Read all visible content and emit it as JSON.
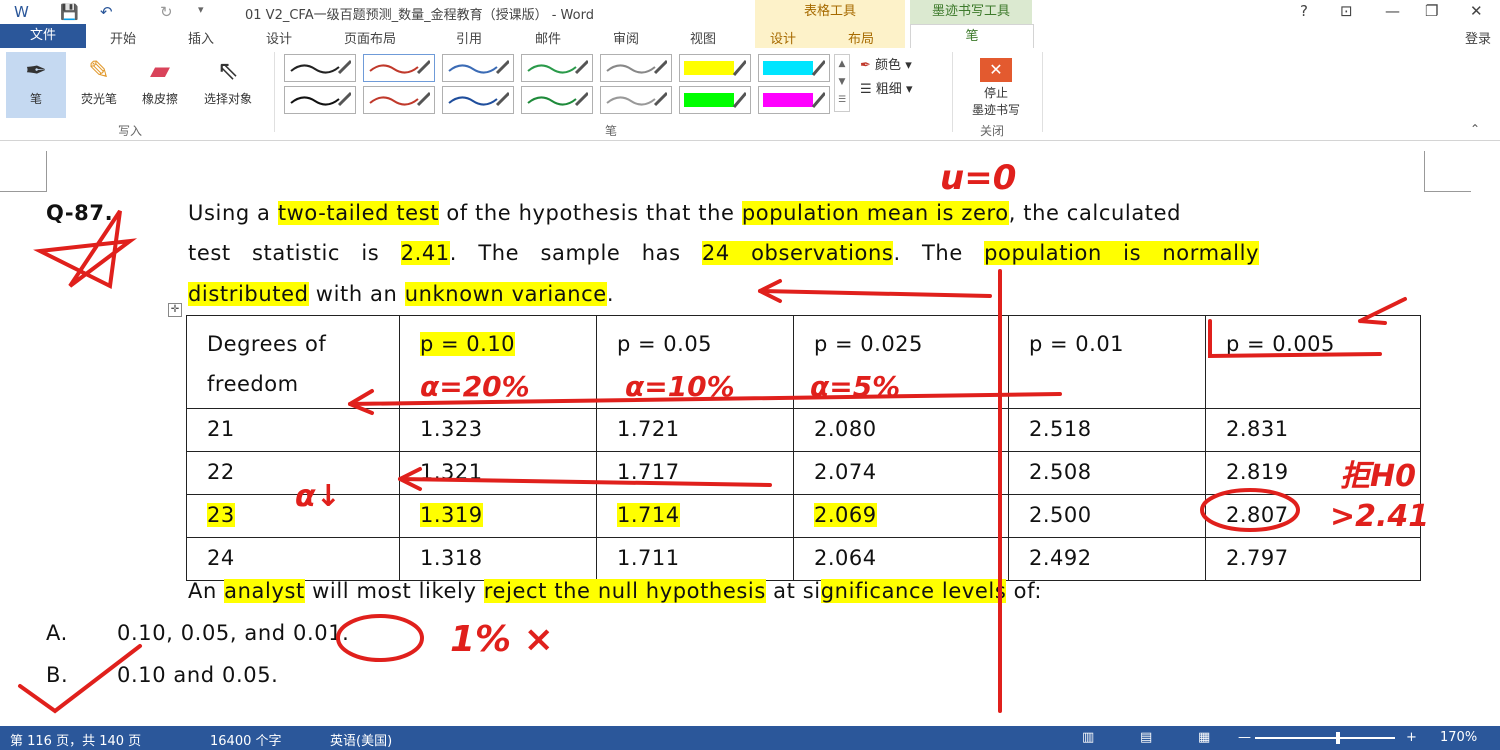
{
  "titlebar": {
    "title": "01 V2_CFA一级百题预测_数量_金程教育（授课版） - Word",
    "context_groups": [
      "表格工具",
      "墨迹书写工具"
    ],
    "help": "?",
    "login": "登录"
  },
  "tabs": {
    "file": "文件",
    "items": [
      "开始",
      "插入",
      "设计",
      "页面布局",
      "引用",
      "邮件",
      "审阅",
      "视图"
    ],
    "table_design": "设计",
    "table_layout": "布局",
    "pen": "笔"
  },
  "ribbon": {
    "write_tools": [
      "笔",
      "荧光笔",
      "橡皮擦",
      "选择对象"
    ],
    "write_group": "写入",
    "pen_group": "笔",
    "color": "颜色",
    "thickness": "粗细",
    "stop_label_1": "停止",
    "stop_label_2": "墨迹书写",
    "close_group": "关闭",
    "swatch_colors": [
      "#222222",
      "#c0392b",
      "#3b6bb5",
      "#2a9a4a",
      "#888888",
      "#ffff00",
      "#00e5ff",
      "#111111",
      "#c0392b",
      "#1f4e9c",
      "#1e8a3a",
      "#999999",
      "#00ff00",
      "#ff00ff"
    ]
  },
  "question": {
    "number": "Q-87.",
    "line1_parts": [
      "Using a ",
      "two-tailed test",
      " of the hypothesis that the ",
      "population mean is zero",
      ", the calculated"
    ],
    "line2_parts": [
      "test statistic is ",
      "2.41",
      ". The sample has ",
      "24 observations",
      ". The ",
      "population is normally"
    ],
    "line3_parts": [
      "distributed",
      " with an ",
      "unknown variance",
      "."
    ],
    "table_header": [
      "Degrees of freedom",
      "p = 0.10",
      "p = 0.05",
      "p = 0.025",
      "p = 0.01",
      "p = 0.005"
    ],
    "table_rows": [
      [
        "21",
        "1.323",
        "1.721",
        "2.080",
        "2.518",
        "2.831"
      ],
      [
        "22",
        "1.321",
        "1.717",
        "2.074",
        "2.508",
        "2.819"
      ],
      [
        "23",
        "1.319",
        "1.714",
        "2.069",
        "2.500",
        "2.807"
      ],
      [
        "24",
        "1.318",
        "1.711",
        "2.064",
        "2.492",
        "2.797"
      ]
    ],
    "prompt_parts": [
      "An ",
      "analyst",
      " will most likely ",
      "reject the null hypothesis",
      " at si",
      "gnificance levels",
      " of:"
    ],
    "options": [
      {
        "letter": "A.",
        "text": "0.10, 0.05, and 0.01."
      },
      {
        "letter": "B.",
        "text": "0.10 and 0.05."
      }
    ]
  },
  "annotations": {
    "mu": "u=0",
    "alpha1": "α=20%",
    "alpha2": "α=10%",
    "alpha3": "α=5%",
    "alpha_down": "α↓",
    "reject": "拒H0",
    "gt": ">2.41",
    "one_percent": "1% ×"
  },
  "statusbar": {
    "page": "第 116 页，共 140 页",
    "words": "16400 个字",
    "lang": "英语(美国)",
    "zoom": "170%"
  },
  "colors": {
    "accent": "#2b579a",
    "highlight": "#ffff00",
    "ink": "#e0201c"
  }
}
